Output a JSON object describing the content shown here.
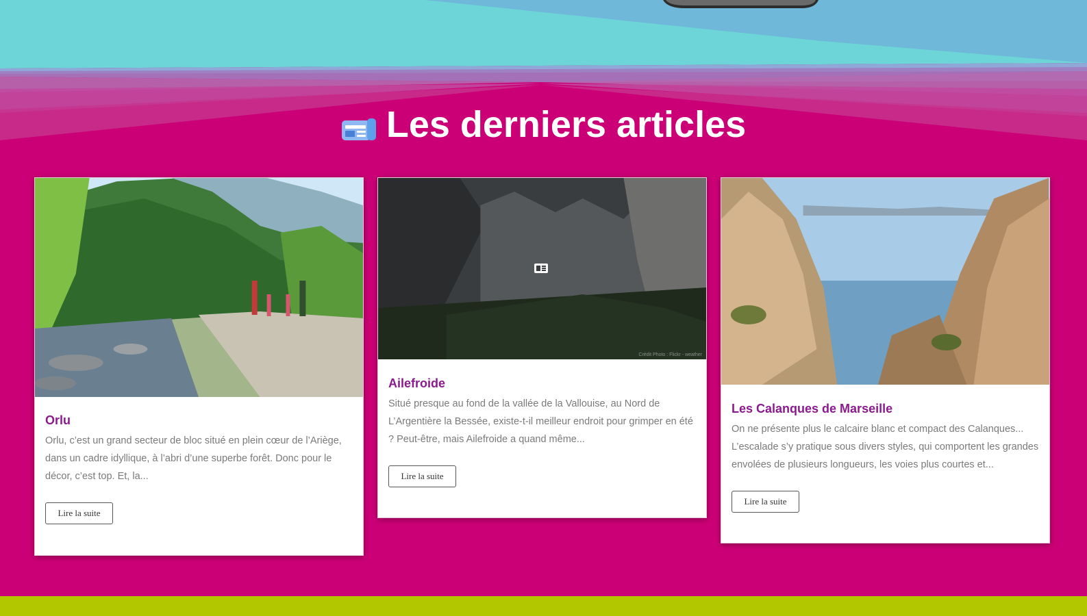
{
  "section": {
    "title": "Les derniers articles",
    "title_icon": "newspaper-icon"
  },
  "colors": {
    "background": "#cc0076",
    "top_band": "#6dd5d8",
    "card_title": "#8a1a8e",
    "footer_band": "#b3c700"
  },
  "articles": [
    {
      "title": "Orlu",
      "excerpt": "Orlu, c’est un grand secteur de bloc situé en plein cœur de l’Ariège, dans un cadre idyllique, à l’abri d’une superbe forêt. Donc pour le décor, c’est top. Et, la...",
      "button": "Lire la suite",
      "image": "river-hikers-photo"
    },
    {
      "title": "Ailefroide",
      "excerpt": "Situé presque au fond de la vallée de la Vallouise, au Nord de L’Argentière la Bessée, existe-t-il meilleur endroit pour grimper en été ? Peut-être, mais Ailefroide a quand même...",
      "button": "Lire la suite",
      "image": "mountain-valley-photo",
      "credit": "Crédit Photo : Flickr - weather"
    },
    {
      "title": "Les Calanques de Marseille",
      "excerpt": "On ne présente plus le calcaire blanc et compact des Calanques... L’escalade s’y pratique sous divers styles, qui comportent les grandes envolées de plusieurs longueurs, les voies plus courtes et...",
      "button": "Lire la suite",
      "image": "calanques-cliffs-photo"
    }
  ]
}
